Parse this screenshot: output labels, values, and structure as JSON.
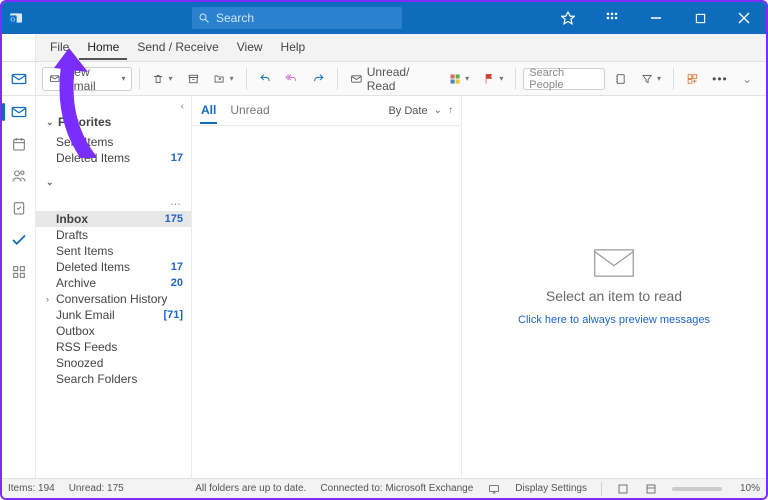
{
  "titlebar": {
    "search_placeholder": "Search"
  },
  "menubar": {
    "file": "File",
    "home": "Home",
    "send_receive": "Send / Receive",
    "view": "View",
    "help": "Help"
  },
  "ribbon": {
    "new_email": "New Email",
    "unread_read": "Unread/ Read",
    "search_people_placeholder": "Search People"
  },
  "folders": {
    "favorites_label": "Favorites",
    "favs": [
      {
        "name": "Sent Items",
        "count": ""
      },
      {
        "name": "Deleted Items",
        "count": "17"
      }
    ],
    "account_items": [
      {
        "name": "Inbox",
        "count": "175",
        "selected": true
      },
      {
        "name": "Drafts",
        "count": ""
      },
      {
        "name": "Sent Items",
        "count": ""
      },
      {
        "name": "Deleted Items",
        "count": "17"
      },
      {
        "name": "Archive",
        "count": "20"
      },
      {
        "name": "Conversation History",
        "count": "",
        "expandable": true
      },
      {
        "name": "Junk Email",
        "count": "[71]"
      },
      {
        "name": "Outbox",
        "count": ""
      },
      {
        "name": "RSS Feeds",
        "count": ""
      },
      {
        "name": "Snoozed",
        "count": ""
      },
      {
        "name": "Search Folders",
        "count": ""
      }
    ]
  },
  "listpane": {
    "tab_all": "All",
    "tab_unread": "Unread",
    "sort_label": "By Date",
    "sort_glyph": "↑"
  },
  "reading": {
    "headline": "Select an item to read",
    "link": "Click here to always preview messages"
  },
  "statusbar": {
    "items": "Items: 194",
    "unread": "Unread: 175",
    "uptodate": "All folders are up to date.",
    "connected": "Connected to: Microsoft Exchange",
    "display": "Display Settings",
    "zoom": "10%"
  }
}
